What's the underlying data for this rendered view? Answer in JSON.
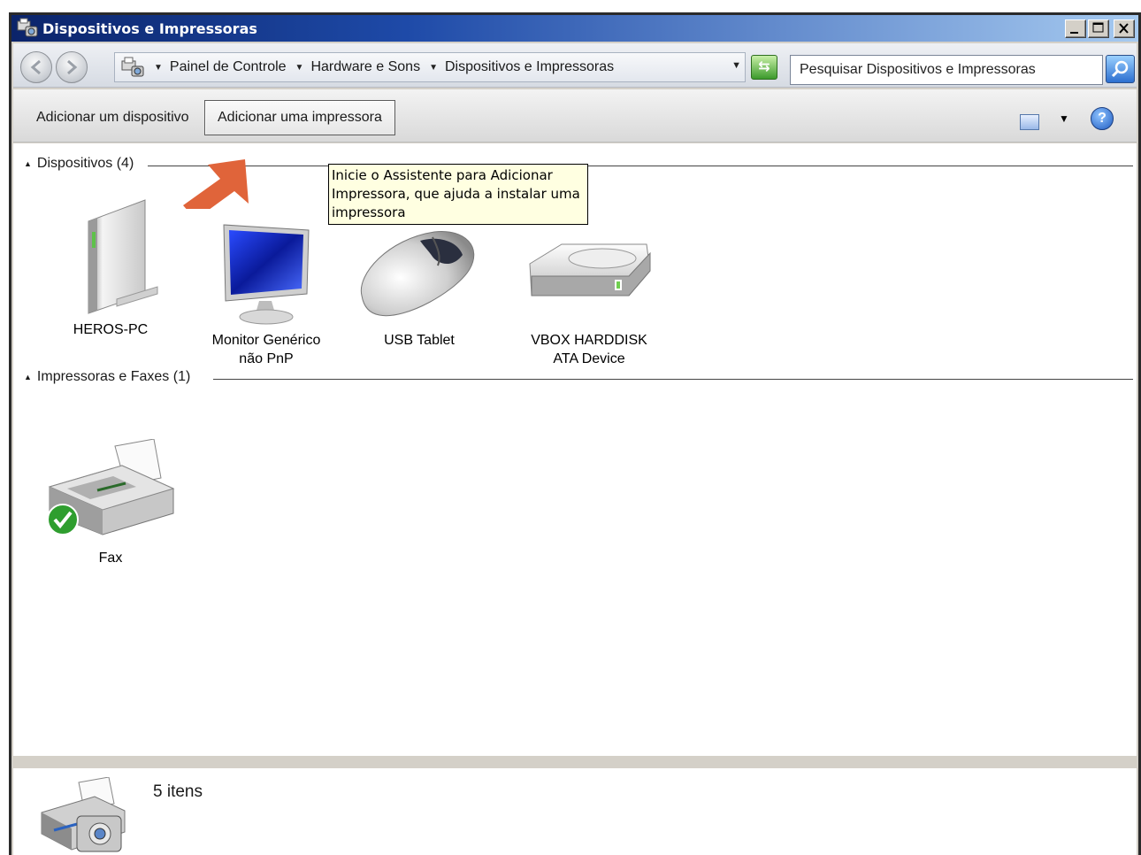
{
  "window": {
    "title": "Dispositivos e Impressoras"
  },
  "address": {
    "crumbs": [
      "Painel de Controle",
      "Hardware e Sons",
      "Dispositivos e Impressoras"
    ],
    "search_placeholder": "Pesquisar Dispositivos e Impressoras"
  },
  "toolbar": {
    "add_device": "Adicionar um dispositivo",
    "add_printer": "Adicionar uma impressora"
  },
  "tooltip": {
    "line1": "Inicie o Assistente para Adicionar",
    "line2": "Impressora, que ajuda a instalar uma",
    "line3": "impressora"
  },
  "groups": {
    "devices": {
      "header": "Dispositivos (4)",
      "items": [
        {
          "line1": "HEROS-PC",
          "line2": "",
          "icon": "computer-icon"
        },
        {
          "line1": "Monitor Genérico",
          "line2": "não PnP",
          "icon": "monitor-icon"
        },
        {
          "line1": "USB Tablet",
          "line2": "",
          "icon": "mouse-icon"
        },
        {
          "line1": "VBOX HARDDISK",
          "line2": "ATA Device",
          "icon": "hard-disk-icon"
        }
      ]
    },
    "printers": {
      "header": "Impressoras e Faxes (1)",
      "items": [
        {
          "line1": "Fax",
          "line2": "",
          "icon": "fax-icon"
        }
      ]
    }
  },
  "details": {
    "count_text": "5 itens"
  },
  "colors": {
    "title_start": "#0b246a",
    "title_end": "#a6caf0",
    "tooltip_bg": "#ffffe1",
    "arrow": "#e0643a"
  }
}
